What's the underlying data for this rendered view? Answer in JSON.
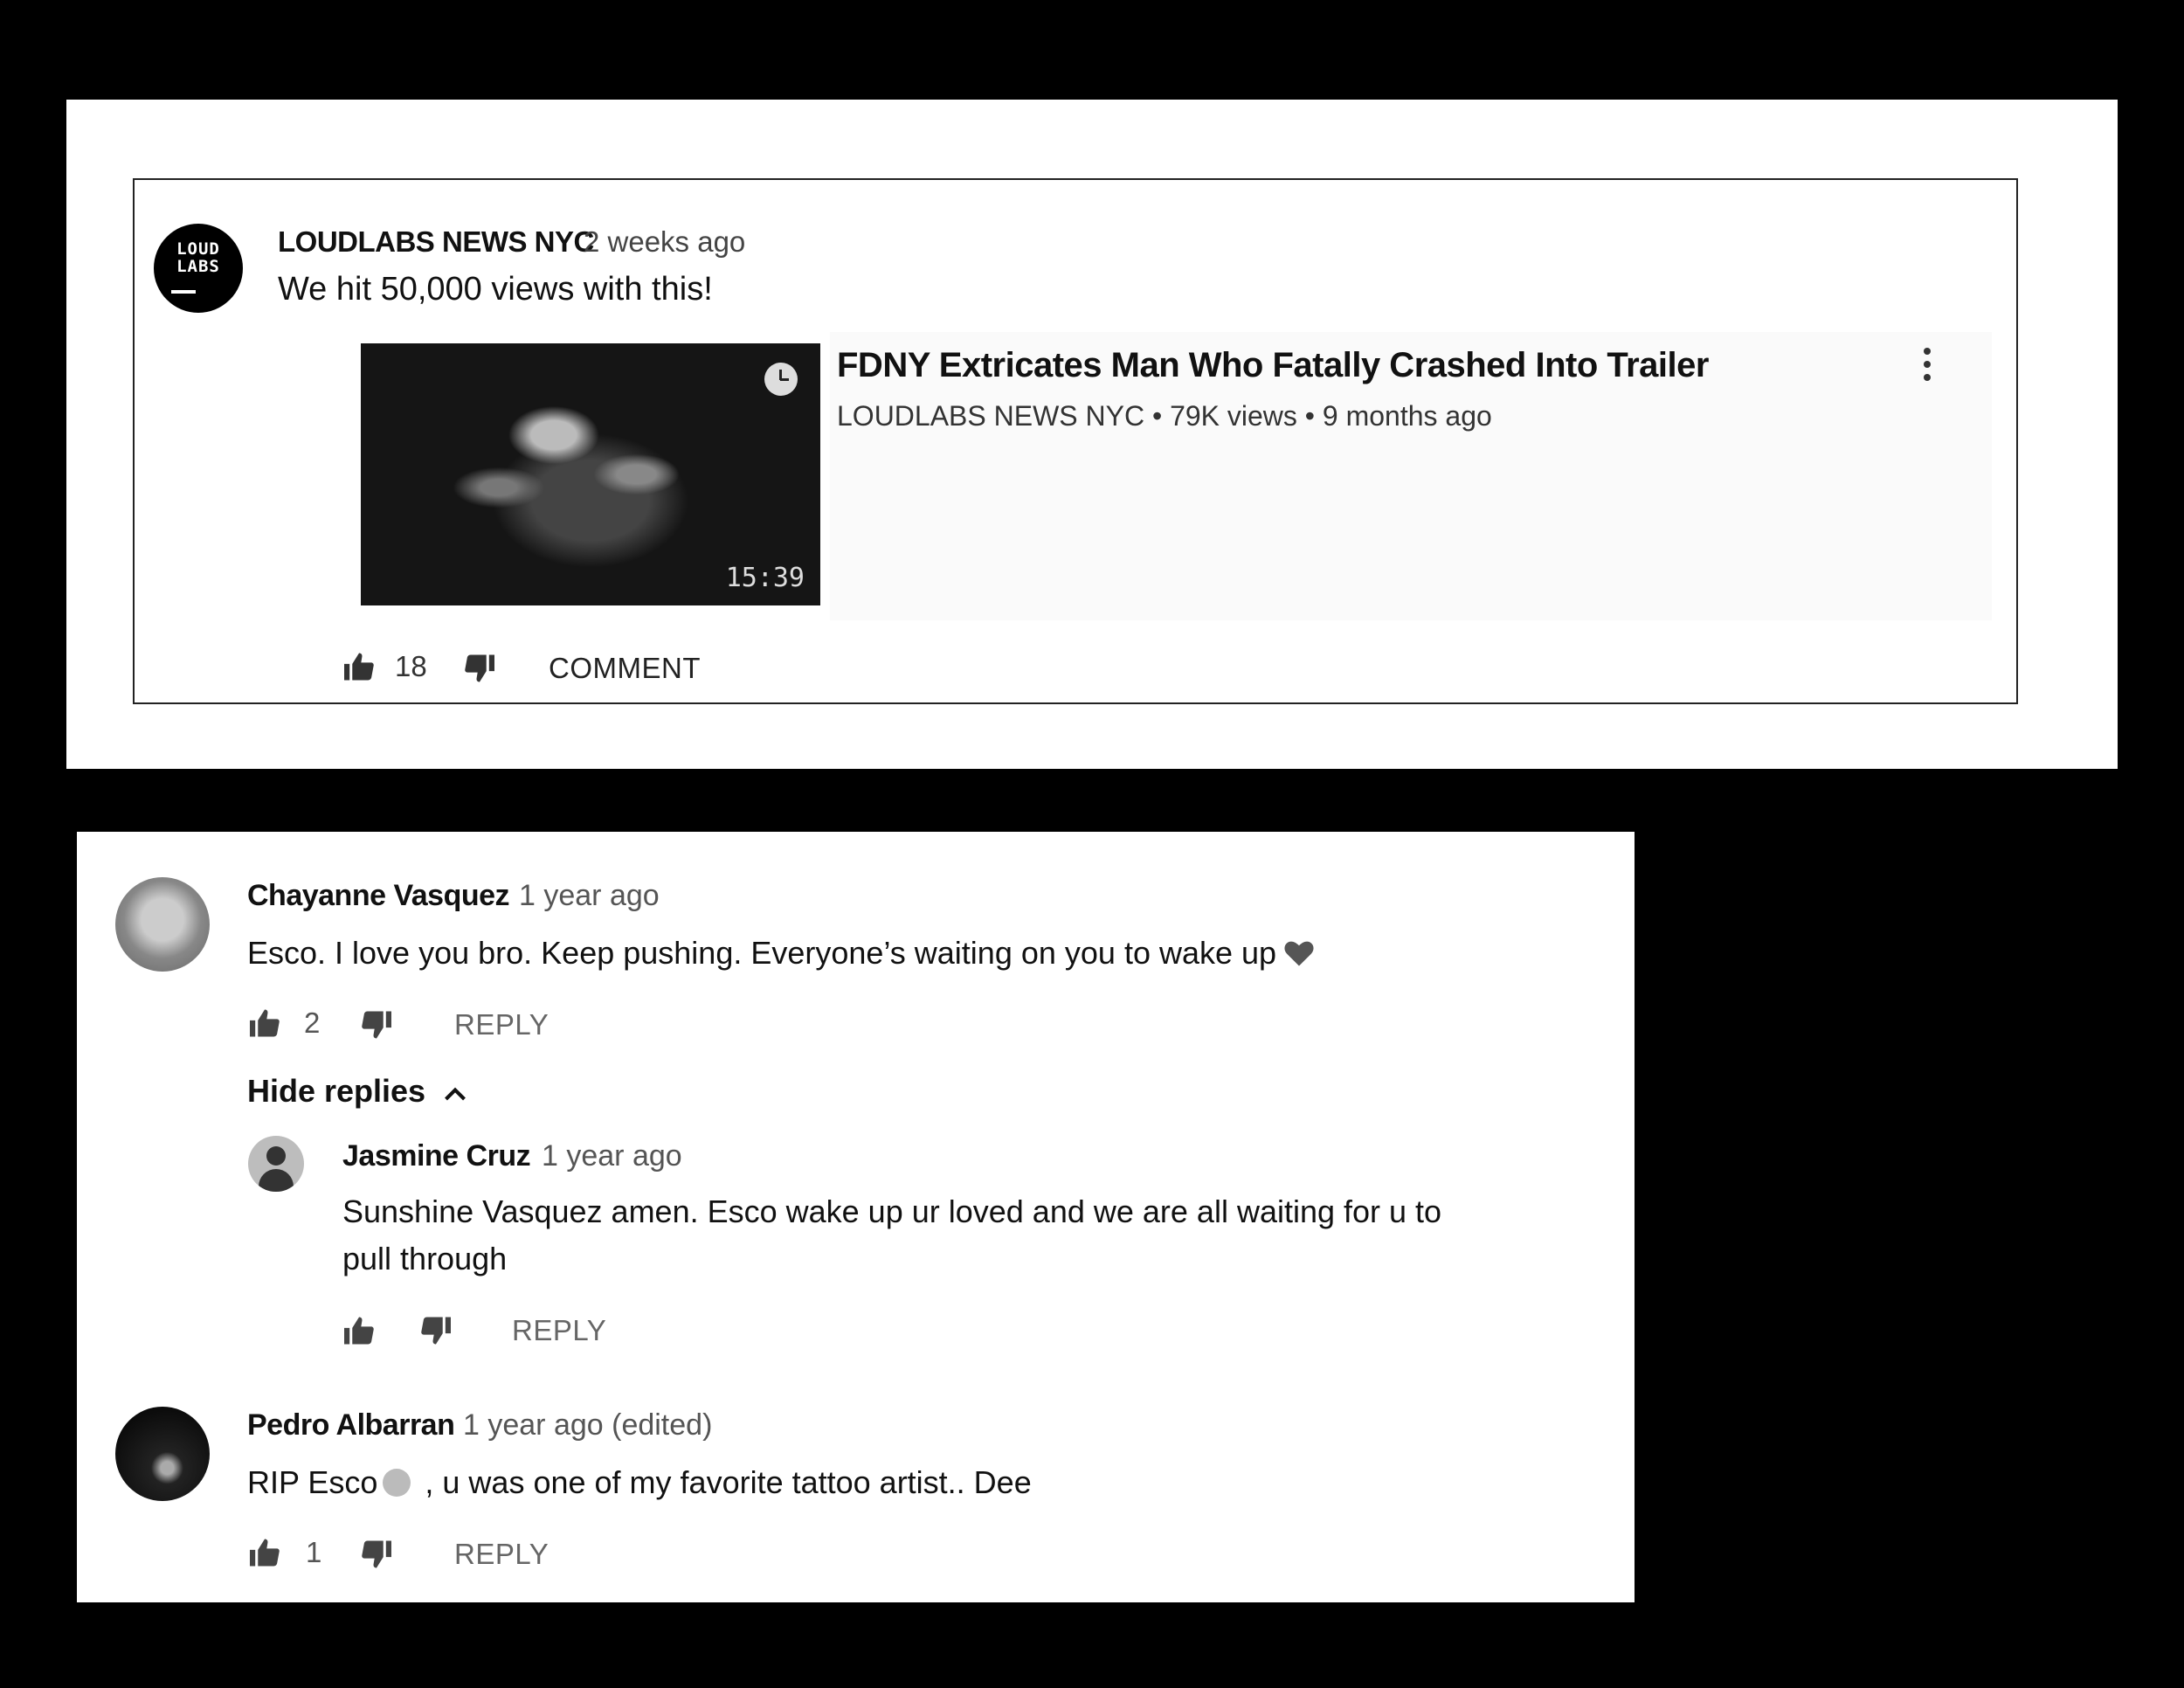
{
  "post": {
    "author": "LOUDLABS NEWS NYC",
    "time": "2 weeks ago",
    "text": "We hit 50,000 views with this!",
    "avatar_logo": "LOUD LABS",
    "likes": "18",
    "comment_label": "COMMENT",
    "video": {
      "title": "FDNY Extricates Man Who Fatally Crashed Into Trailer",
      "meta": "LOUDLABS NEWS NYC • 79K views • 9 months ago",
      "duration": "15:39"
    }
  },
  "comments": [
    {
      "name": "Chayanne Vasquez",
      "time": "1 year ago",
      "text": "Esco. I love you bro. Keep pushing. Everyone’s waiting on you to wake up",
      "likes": "2",
      "reply_label": "REPLY",
      "hide_replies_label": "Hide replies"
    },
    {
      "name": "Jasmine Cruz",
      "time": "1 year ago",
      "text_line1": "Sunshine Vasquez  amen. Esco wake up ur loved and we are all waiting for u to",
      "text_line2": "pull through",
      "reply_label": "REPLY"
    },
    {
      "name": "Pedro Albarran",
      "time": "1 year ago (edited)",
      "text_before": "RIP Esco",
      "text_after": " , u was one of my favorite tattoo artist.. Dee",
      "likes": "1",
      "reply_label": "REPLY"
    }
  ],
  "icons": {
    "like": "thumbs-up-icon",
    "dislike": "thumbs-down-icon",
    "more": "more-vert-icon",
    "clock": "watch-later-icon",
    "heart": "heart-icon",
    "skull": "skull-emoji-icon",
    "chevron": "chevron-up-icon"
  }
}
